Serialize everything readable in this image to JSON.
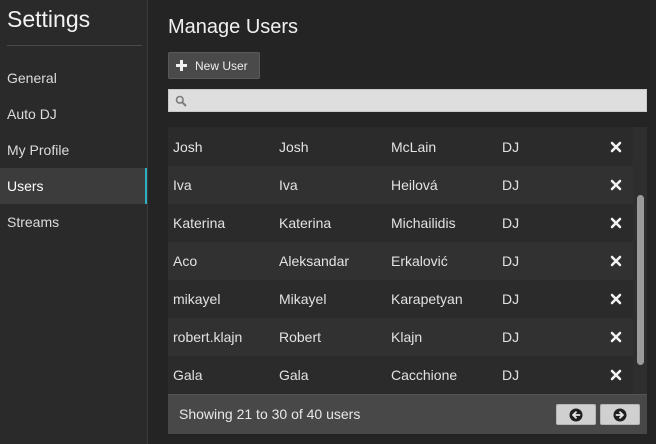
{
  "sidebar": {
    "title": "Settings",
    "items": [
      {
        "label": "General",
        "active": false
      },
      {
        "label": "Auto DJ",
        "active": false
      },
      {
        "label": "My Profile",
        "active": false
      },
      {
        "label": "Users",
        "active": true
      },
      {
        "label": "Streams",
        "active": false
      }
    ]
  },
  "main": {
    "title": "Manage Users",
    "new_user_label": "New User",
    "search": {
      "value": "",
      "placeholder": ""
    },
    "rows": [
      {
        "username": "Josh",
        "first": "Josh",
        "last": "McLain",
        "role": "DJ"
      },
      {
        "username": "Iva",
        "first": "Iva",
        "last": "Heilová",
        "role": "DJ"
      },
      {
        "username": "Katerina",
        "first": "Katerina",
        "last": "Michailidis",
        "role": "DJ"
      },
      {
        "username": "Aco",
        "first": "Aleksandar",
        "last": "Erkalović",
        "role": "DJ"
      },
      {
        "username": "mikayel",
        "first": "Mikayel",
        "last": "Karapetyan",
        "role": "DJ"
      },
      {
        "username": "robert.klajn",
        "first": "Robert",
        "last": "Klajn",
        "role": "DJ"
      },
      {
        "username": "Gala",
        "first": "Gala",
        "last": "Cacchione",
        "role": "DJ"
      }
    ],
    "footer_text": "Showing 21 to 30 of 40 users"
  },
  "colors": {
    "accent": "#2fb0c2",
    "background": "#242424"
  }
}
